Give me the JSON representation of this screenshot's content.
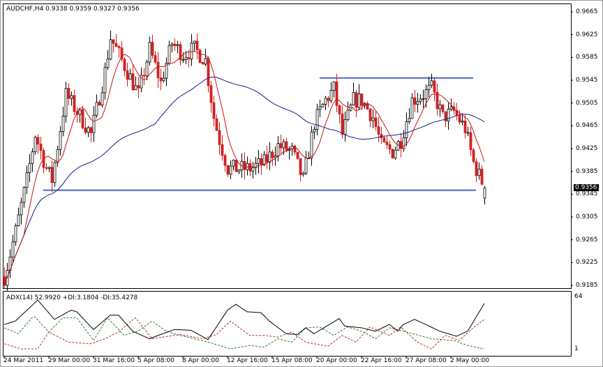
{
  "chart": {
    "title": "AUDCHF,H4  0.9338 0.9359 0.9327 0.9356",
    "current_price": "0.9356"
  },
  "indicator": {
    "title": "ADX(14) 52.9920 +DI:3.1804 -DI:35.4278",
    "scale_top": "64",
    "scale_bottom": "1"
  },
  "colors": {
    "bull": "#ffffff",
    "bear": "#d42020",
    "ma_fast": "#cc1111",
    "ma_slow": "#1a1a8a",
    "level": "#4466cc",
    "adx": "#000000",
    "plus_di": "#2a7a2a",
    "minus_di": "#b03030"
  },
  "chart_data": {
    "type": "candlestick",
    "price_axis": [
      "0.9665",
      "0.9625",
      "0.9585",
      "0.9545",
      "0.9505",
      "0.9465",
      "0.9425",
      "0.9385",
      "0.9345",
      "0.9305",
      "0.9265",
      "0.9225",
      "0.9185"
    ],
    "ylim": [
      0.918,
      0.968
    ],
    "time_axis": [
      {
        "bar": 0,
        "label": "24 Mar 2011"
      },
      {
        "bar": 16,
        "label": "29 Mar 00:00"
      },
      {
        "bar": 32,
        "label": "31 Mar 16:00"
      },
      {
        "bar": 48,
        "label": "5 Apr 08:00"
      },
      {
        "bar": 64,
        "label": "8 Apr 00:00"
      },
      {
        "bar": 80,
        "label": "12 Apr 16:00"
      },
      {
        "bar": 96,
        "label": "15 Apr 08:00"
      },
      {
        "bar": 112,
        "label": "20 Apr 00:00"
      },
      {
        "bar": 128,
        "label": "22 Apr 16:00"
      },
      {
        "bar": 144,
        "label": "27 Apr 08:00"
      },
      {
        "bar": 160,
        "label": "2 May 00:00"
      }
    ],
    "bars": 172,
    "close_keypoints": [
      [
        0,
        0.92
      ],
      [
        4,
        0.928
      ],
      [
        8,
        0.937
      ],
      [
        11,
        0.945
      ],
      [
        15,
        0.939
      ],
      [
        17,
        0.937
      ],
      [
        22,
        0.952
      ],
      [
        26,
        0.949
      ],
      [
        31,
        0.945
      ],
      [
        36,
        0.956
      ],
      [
        38,
        0.962
      ],
      [
        42,
        0.958
      ],
      [
        46,
        0.954
      ],
      [
        48,
        0.952
      ],
      [
        52,
        0.96
      ],
      [
        56,
        0.954
      ],
      [
        60,
        0.961
      ],
      [
        64,
        0.959
      ],
      [
        68,
        0.96
      ],
      [
        72,
        0.958
      ],
      [
        75,
        0.948
      ],
      [
        77,
        0.944
      ],
      [
        80,
        0.939
      ],
      [
        84,
        0.939
      ],
      [
        88,
        0.939
      ],
      [
        93,
        0.94
      ],
      [
        98,
        0.943
      ],
      [
        103,
        0.942
      ],
      [
        107,
        0.937
      ],
      [
        111,
        0.947
      ],
      [
        115,
        0.951
      ],
      [
        118,
        0.953
      ],
      [
        121,
        0.945
      ],
      [
        125,
        0.951
      ],
      [
        128,
        0.951
      ],
      [
        132,
        0.948
      ],
      [
        135,
        0.943
      ],
      [
        139,
        0.942
      ],
      [
        142,
        0.944
      ],
      [
        146,
        0.951
      ],
      [
        150,
        0.952
      ],
      [
        153,
        0.953
      ],
      [
        157,
        0.948
      ],
      [
        161,
        0.949
      ],
      [
        165,
        0.946
      ],
      [
        168,
        0.94
      ],
      [
        172,
        0.9356
      ]
    ],
    "levels": [
      {
        "price": 0.9549,
        "from_bar": 113,
        "to_bar": 168
      },
      {
        "price": 0.9352,
        "from_bar": 14,
        "to_bar": 169
      }
    ],
    "ma_periods": {
      "fast": 8,
      "slow": 55
    },
    "adx_range": [
      1,
      64
    ],
    "adx": [
      [
        0,
        30
      ],
      [
        4,
        34
      ],
      [
        12,
        59
      ],
      [
        18,
        36
      ],
      [
        24,
        47
      ],
      [
        26,
        45
      ],
      [
        32,
        24
      ],
      [
        38,
        41
      ],
      [
        41,
        41
      ],
      [
        46,
        22
      ],
      [
        52,
        13
      ],
      [
        56,
        18
      ],
      [
        61,
        24
      ],
      [
        67,
        23
      ],
      [
        73,
        12
      ],
      [
        80,
        47
      ],
      [
        83,
        54
      ],
      [
        87,
        45
      ],
      [
        92,
        44
      ],
      [
        95,
        34
      ],
      [
        101,
        19
      ],
      [
        105,
        18
      ],
      [
        108,
        26
      ],
      [
        111,
        19
      ],
      [
        116,
        29
      ],
      [
        120,
        37
      ],
      [
        122,
        28
      ],
      [
        128,
        26
      ],
      [
        133,
        22
      ],
      [
        138,
        30
      ],
      [
        141,
        22
      ],
      [
        143,
        30
      ],
      [
        147,
        36
      ],
      [
        151,
        30
      ],
      [
        156,
        22
      ],
      [
        162,
        16
      ],
      [
        166,
        22
      ],
      [
        172,
        55
      ]
    ],
    "plus_di": [
      [
        0,
        26
      ],
      [
        5,
        19
      ],
      [
        10,
        38
      ],
      [
        11,
        39
      ],
      [
        16,
        21
      ],
      [
        21,
        38
      ],
      [
        26,
        38
      ],
      [
        32,
        11
      ],
      [
        37,
        38
      ],
      [
        43,
        17
      ],
      [
        48,
        22
      ],
      [
        53,
        34
      ],
      [
        58,
        22
      ],
      [
        63,
        17
      ],
      [
        73,
        9
      ],
      [
        81,
        1
      ],
      [
        88,
        5
      ],
      [
        93,
        3
      ],
      [
        98,
        13
      ],
      [
        103,
        9
      ],
      [
        108,
        26
      ],
      [
        113,
        27
      ],
      [
        118,
        17
      ],
      [
        123,
        27
      ],
      [
        128,
        22
      ],
      [
        133,
        13
      ],
      [
        138,
        26
      ],
      [
        143,
        22
      ],
      [
        153,
        13
      ],
      [
        161,
        11
      ],
      [
        166,
        5
      ],
      [
        172,
        1
      ]
    ],
    "minus_di": [
      [
        0,
        7
      ],
      [
        6,
        1
      ],
      [
        12,
        1
      ],
      [
        16,
        21
      ],
      [
        23,
        9
      ],
      [
        31,
        7
      ],
      [
        36,
        13
      ],
      [
        41,
        21
      ],
      [
        47,
        38
      ],
      [
        53,
        13
      ],
      [
        63,
        18
      ],
      [
        71,
        13
      ],
      [
        76,
        18
      ],
      [
        81,
        34
      ],
      [
        88,
        17
      ],
      [
        93,
        17
      ],
      [
        98,
        15
      ],
      [
        103,
        21
      ],
      [
        108,
        9
      ],
      [
        116,
        4
      ],
      [
        121,
        17
      ],
      [
        126,
        9
      ],
      [
        131,
        27
      ],
      [
        138,
        17
      ],
      [
        142,
        27
      ],
      [
        148,
        9
      ],
      [
        153,
        1
      ],
      [
        158,
        17
      ],
      [
        163,
        11
      ],
      [
        168,
        26
      ],
      [
        172,
        36
      ]
    ]
  }
}
